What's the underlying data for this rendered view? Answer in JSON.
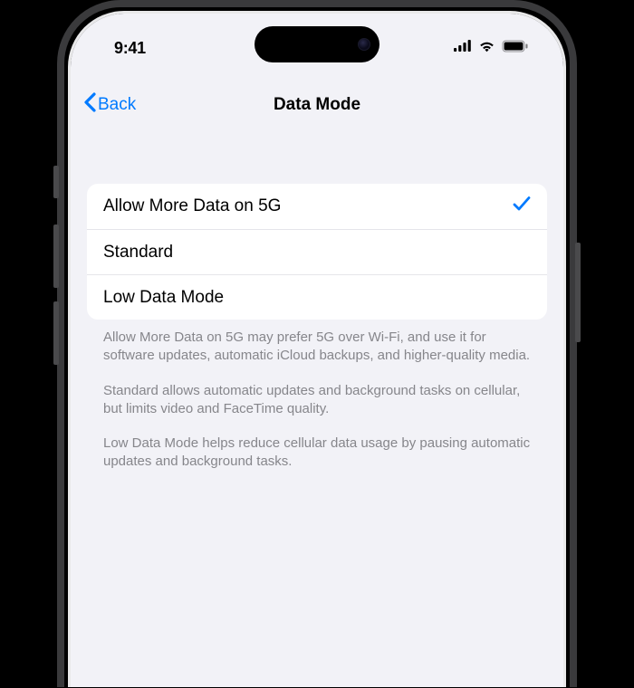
{
  "status": {
    "time": "9:41"
  },
  "nav": {
    "back_label": "Back",
    "title": "Data Mode"
  },
  "options": [
    {
      "label": "Allow More Data on 5G",
      "selected": true
    },
    {
      "label": "Standard",
      "selected": false
    },
    {
      "label": "Low Data Mode",
      "selected": false
    }
  ],
  "footer": {
    "p1": "Allow More Data on 5G may prefer 5G over Wi-Fi, and use it for software updates, automatic iCloud backups, and higher-quality media.",
    "p2": "Standard allows automatic updates and background tasks on cellular, but limits video and FaceTime quality.",
    "p3": "Low Data Mode helps reduce cellular data usage by pausing automatic updates and background tasks."
  },
  "colors": {
    "accent": "#007aff",
    "background": "#f2f2f7"
  }
}
